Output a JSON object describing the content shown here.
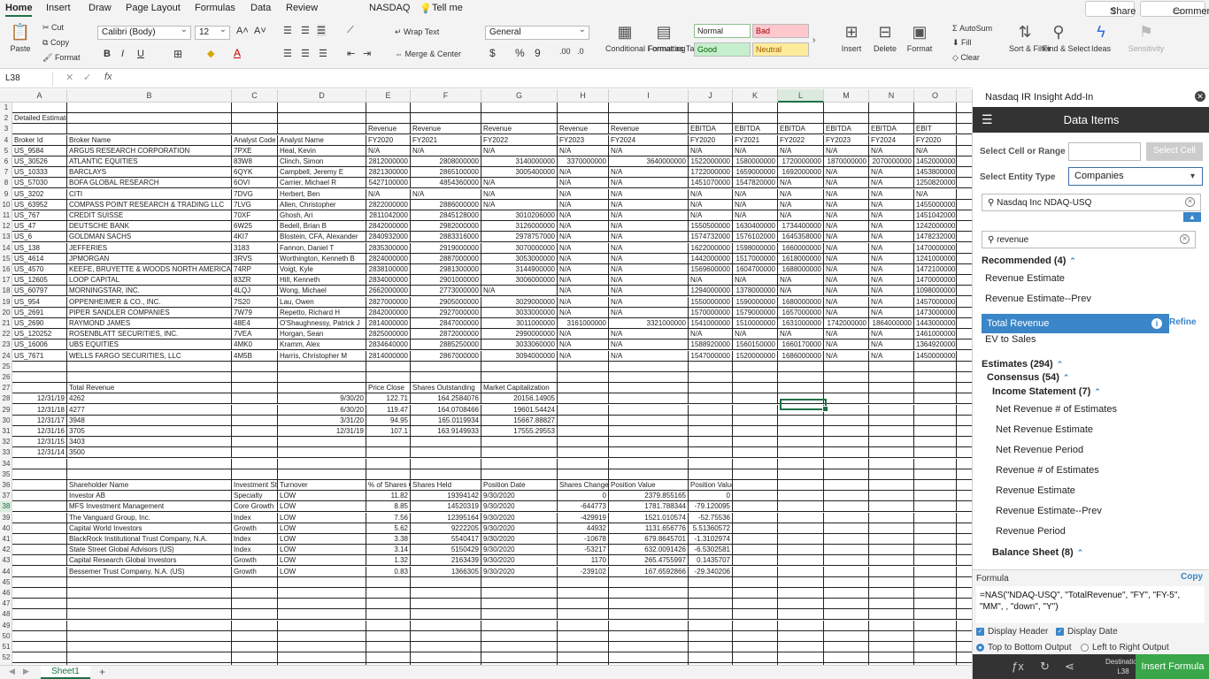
{
  "menu": {
    "tabs": [
      "Home",
      "Insert",
      "Draw",
      "Page Layout",
      "Formulas",
      "Data",
      "Review",
      "NASDAQ"
    ],
    "tell_me": "Tell me",
    "share": "Share",
    "comments": "Comments"
  },
  "ribbon": {
    "paste": "Paste",
    "cut": "Cut",
    "copy": "Copy",
    "format": "Format",
    "font_name": "Calibri (Body)",
    "font_size": "12",
    "wrap_text": "Wrap Text",
    "merge_center": "Merge & Center",
    "number_format": "General",
    "conditional": "Conditional Formatting",
    "format_table": "Format as Table",
    "style_normal": "Normal",
    "style_bad": "Bad",
    "style_good": "Good",
    "style_neutral": "Neutral",
    "insert": "Insert",
    "delete": "Delete",
    "format2": "Format",
    "autosum": "AutoSum",
    "fill": "Fill",
    "clear": "Clear",
    "sort_filter": "Sort & Filter",
    "find_select": "Find & Select",
    "ideas": "Ideas",
    "sensitivity": "Sensitivity"
  },
  "formula_bar": {
    "name_box": "L38",
    "fx": "fx"
  },
  "columns": [
    {
      "label": "A"
    },
    {
      "label": "B"
    },
    {
      "label": "C"
    },
    {
      "label": "D"
    },
    {
      "label": "E"
    },
    {
      "label": "F"
    },
    {
      "label": "G"
    },
    {
      "label": "H"
    },
    {
      "label": "I"
    },
    {
      "label": "J"
    },
    {
      "label": "K"
    },
    {
      "label": "L"
    },
    {
      "label": "M"
    },
    {
      "label": "N"
    },
    {
      "label": "O"
    }
  ],
  "row_numbers": [
    "1",
    "2",
    "3",
    "4",
    "5",
    "6",
    "7",
    "8",
    "9",
    "10",
    "11",
    "12",
    "13",
    "14",
    "15",
    "16",
    "17",
    "18",
    "19",
    "20",
    "21",
    "22",
    "23",
    "24",
    "25",
    "26",
    "27",
    "28",
    "29",
    "30",
    "31",
    "32",
    "33",
    "34",
    "35",
    "36",
    "37",
    "38",
    "39",
    "40",
    "41",
    "42",
    "43",
    "44",
    "45",
    "46",
    "47",
    "48",
    "49",
    "50",
    "51",
    "52",
    "53",
    "54",
    "55"
  ],
  "rows": [
    [],
    [
      "Detailed Estimates"
    ],
    [
      "",
      "",
      "",
      "",
      "Revenue",
      "Revenue",
      "Revenue",
      "Revenue",
      "Revenue",
      "EBITDA",
      "EBITDA",
      "EBITDA",
      "EBITDA",
      "EBITDA",
      "EBIT"
    ],
    [
      "Broker Id",
      "Broker Name",
      "Analyst Code",
      "Analyst Name",
      "FY2020",
      "FY2021",
      "FY2022",
      "FY2023",
      "FY2024",
      "FY2020",
      "FY2021",
      "FY2022",
      "FY2023",
      "FY2024",
      "FY2020"
    ],
    [
      "US_9584",
      "ARGUS RESEARCH CORPORATION",
      "7PXE",
      "Heal, Kevin",
      "N/A",
      "N/A",
      "N/A",
      "N/A",
      "N/A",
      "N/A",
      "N/A",
      "N/A",
      "N/A",
      "N/A",
      "N/A"
    ],
    [
      "US_30526",
      "ATLANTIC EQUITIES",
      "83W8",
      "Clinch, Simon",
      "2812000000",
      "2808000000",
      "3140000000",
      "3370000000",
      "3640000000",
      "1522000000",
      "1580000000",
      "1720000000",
      "1870000000",
      "2070000000",
      "1452000000"
    ],
    [
      "US_10333",
      "BARCLAYS",
      "6QYK",
      "Campbell, Jeremy E",
      "2821300000",
      "2865100000",
      "3005400000",
      "N/A",
      "N/A",
      "1722000000",
      "1659000000",
      "1692000000",
      "N/A",
      "N/A",
      "1453800000"
    ],
    [
      "US_57030",
      "BOFA GLOBAL RESEARCH",
      "6OVI",
      "Carrier, Michael R",
      "5427100000",
      "4854360000",
      "N/A",
      "N/A",
      "N/A",
      "1451070000",
      "1547820000",
      "N/A",
      "N/A",
      "N/A",
      "1250820000"
    ],
    [
      "US_3202",
      "CITI",
      "7DVG",
      "Herbert, Ben",
      "N/A",
      "N/A",
      "N/A",
      "N/A",
      "N/A",
      "N/A",
      "N/A",
      "N/A",
      "N/A",
      "N/A",
      "N/A"
    ],
    [
      "US_63952",
      "COMPASS POINT RESEARCH & TRADING LLC",
      "7LVG",
      "Allen, Christopher",
      "2822000000",
      "2886000000",
      "N/A",
      "N/A",
      "N/A",
      "N/A",
      "N/A",
      "N/A",
      "N/A",
      "N/A",
      "1455000000"
    ],
    [
      "US_767",
      "CREDIT SUISSE",
      "70XF",
      "Ghosh, Ari",
      "2811042000",
      "2845128000",
      "3010206000",
      "N/A",
      "N/A",
      "N/A",
      "N/A",
      "N/A",
      "N/A",
      "N/A",
      "1451042000"
    ],
    [
      "US_47",
      "DEUTSCHE BANK",
      "6W25",
      "Bedell, Brian B",
      "2842000000",
      "2982000000",
      "3126000000",
      "N/A",
      "N/A",
      "1550500000",
      "1630400000",
      "1734400000",
      "N/A",
      "N/A",
      "1242000000"
    ],
    [
      "US_6",
      "GOLDMAN SACHS",
      "4KI7",
      "Blostein, CFA, Alexander",
      "2840932000",
      "2883316000",
      "2978757000",
      "N/A",
      "N/A",
      "1574732000",
      "1576102000",
      "1645358000",
      "N/A",
      "N/A",
      "1478232000"
    ],
    [
      "US_138",
      "JEFFERIES",
      "3183",
      "Fannon, Daniel T",
      "2835300000",
      "2919000000",
      "3070000000",
      "N/A",
      "N/A",
      "1622000000",
      "1598000000",
      "1660000000",
      "N/A",
      "N/A",
      "1470000000"
    ],
    [
      "US_4614",
      "JPMORGAN",
      "3RVS",
      "Worthington, Kenneth B",
      "2824000000",
      "2887000000",
      "3053000000",
      "N/A",
      "N/A",
      "1442000000",
      "1517000000",
      "1618000000",
      "N/A",
      "N/A",
      "1241000000"
    ],
    [
      "US_4570",
      "KEEFE, BRUYETTE & WOODS NORTH AMERICA",
      "74RP",
      "Voigt, Kyle",
      "2838100000",
      "2981300000",
      "3144900000",
      "N/A",
      "N/A",
      "1569600000",
      "1604700000",
      "1688000000",
      "N/A",
      "N/A",
      "1472100000"
    ],
    [
      "US_12605",
      "LOOP CAPITAL",
      "83ZR",
      "Hill, Kenneth",
      "2834000000",
      "2901000000",
      "3006000000",
      "N/A",
      "N/A",
      "N/A",
      "N/A",
      "N/A",
      "N/A",
      "N/A",
      "1470000000"
    ],
    [
      "US_60797",
      "MORNINGSTAR, INC.",
      "4LQJ",
      "Wong, Michael",
      "2662000000",
      "2773000000",
      "N/A",
      "N/A",
      "N/A",
      "1294000000",
      "1378000000",
      "N/A",
      "N/A",
      "N/A",
      "1098000000"
    ],
    [
      "US_954",
      "OPPENHEIMER & CO., INC.",
      "7S20",
      "Lau, Owen",
      "2827000000",
      "2905000000",
      "3029000000",
      "N/A",
      "N/A",
      "1550000000",
      "1590000000",
      "1680000000",
      "N/A",
      "N/A",
      "1457000000"
    ],
    [
      "US_2691",
      "PIPER SANDLER COMPANIES",
      "7W79",
      "Repetto, Richard H",
      "2842000000",
      "2927000000",
      "3033000000",
      "N/A",
      "N/A",
      "1570000000",
      "1579000000",
      "1657000000",
      "N/A",
      "N/A",
      "1473000000"
    ],
    [
      "US_2690",
      "RAYMOND JAMES",
      "48E4",
      "O'Shaughnessy, Patrick J",
      "2814000000",
      "2847000000",
      "3011000000",
      "3161000000",
      "3321000000",
      "1541000000",
      "1510000000",
      "1631000000",
      "1742000000",
      "1864000000",
      "1443000000"
    ],
    [
      "US_120252",
      "ROSENBLATT SECURITIES, INC.",
      "7VEA",
      "Horgan, Sean",
      "2825000000",
      "2872000000",
      "2990000000",
      "N/A",
      "N/A",
      "N/A",
      "N/A",
      "N/A",
      "N/A",
      "N/A",
      "1461000000"
    ],
    [
      "US_16006",
      "UBS EQUITIES",
      "4MK0",
      "Kramm, Alex",
      "2834640000",
      "2885250000",
      "3033060000",
      "N/A",
      "N/A",
      "1588920000",
      "1560150000",
      "1660170000",
      "N/A",
      "N/A",
      "1364920000"
    ],
    [
      "US_7671",
      "WELLS FARGO SECURITIES, LLC",
      "4M5B",
      "Harris, Christopher M",
      "2814000000",
      "2867000000",
      "3094000000",
      "N/A",
      "N/A",
      "1547000000",
      "1520000000",
      "1686000000",
      "N/A",
      "N/A",
      "1450000000"
    ],
    [],
    [],
    [
      "",
      "Total Revenue",
      "",
      "",
      "Price Close",
      "Shares Outstanding",
      "Market Capitalization"
    ],
    [
      "12/31/19",
      "4262",
      "",
      "9/30/20",
      "122.71",
      "164.2584076",
      "20156.14905"
    ],
    [
      "12/31/18",
      "4277",
      "",
      "6/30/20",
      "119.47",
      "164.0708466",
      "19601.54424"
    ],
    [
      "12/31/17",
      "3948",
      "",
      "3/31/20",
      "94.95",
      "165.0119934",
      "15667.88827"
    ],
    [
      "12/31/16",
      "3705",
      "",
      "12/31/19",
      "107.1",
      "163.9149933",
      "17555.29553"
    ],
    [
      "12/31/15",
      "3403"
    ],
    [
      "12/31/14",
      "3500"
    ],
    [],
    [],
    [
      "",
      "Shareholder Name",
      "Investment St",
      "Turnover",
      "% of Shares C",
      "Shares Held",
      "Position Date",
      "Shares Change",
      "Position Value",
      "Position Value Change"
    ],
    [
      "",
      "Investor AB",
      "Specialty",
      "LOW",
      "11.82",
      "19394142",
      "9/30/2020",
      "0",
      "2379.855165",
      "0"
    ],
    [
      "",
      "MFS Investment Management",
      "Core Growth",
      "LOW",
      "8.85",
      "14520319",
      "9/30/2020",
      "-644773",
      "1781.788344",
      "-79.120095"
    ],
    [
      "",
      "The Vanguard Group, Inc.",
      "Index",
      "LOW",
      "7.56",
      "12395164",
      "9/30/2020",
      "-429919",
      "1521.010574",
      "-52.75536"
    ],
    [
      "",
      "Capital World Investors",
      "Growth",
      "LOW",
      "5.62",
      "9222205",
      "9/30/2020",
      "44932",
      "1131.656776",
      "5.51360572"
    ],
    [
      "",
      "BlackRock Institutional Trust Company, N.A.",
      "Index",
      "LOW",
      "3.38",
      "5540417",
      "9/30/2020",
      "-10678",
      "679.8645701",
      "-1.3102974"
    ],
    [
      "",
      "State Street Global Advisors (US)",
      "Index",
      "LOW",
      "3.14",
      "5150429",
      "9/30/2020",
      "-53217",
      "632.0091426",
      "-6.5302581"
    ],
    [
      "",
      "Capital Research Global Investors",
      "Growth",
      "LOW",
      "1.32",
      "2163439",
      "9/30/2020",
      "1170",
      "265.4755997",
      "0.1435707"
    ],
    [
      "",
      "Bessemer Trust Company, N.A. (US)",
      "Growth",
      "LOW",
      "0.83",
      "1366305",
      "9/30/2020",
      "-239102",
      "167.6592866",
      "-29.340206"
    ]
  ],
  "sheet": {
    "tab": "Sheet1"
  },
  "pane": {
    "title": "Nasdaq IR Insight Add-In",
    "header": "Data Items",
    "select_cell_label": "Select Cell or Range",
    "select_cell_btn": "Select Cell",
    "entity_type_label": "Select Entity Type",
    "entity_type_value": "Companies",
    "entity_search": "Nasdaq Inc  NDAQ-USQ",
    "item_search": "revenue",
    "refine": "Refine",
    "items": [
      {
        "label": "Recommended (4)",
        "kind": "h"
      },
      {
        "label": "Revenue Estimate",
        "kind": ""
      },
      {
        "label": "Revenue Estimate--Prev",
        "kind": ""
      },
      {
        "label": "Total Revenue",
        "kind": "sel"
      },
      {
        "label": "EV to Sales",
        "kind": ""
      },
      {
        "label": "Estimates (294)",
        "kind": "h"
      },
      {
        "label": "Consensus (54)",
        "kind": "h"
      },
      {
        "label": "Income Statement (7)",
        "kind": "h"
      },
      {
        "label": "Net Revenue # of Estimates",
        "kind": ""
      },
      {
        "label": "Net Revenue Estimate",
        "kind": ""
      },
      {
        "label": "Net Revenue Period",
        "kind": ""
      },
      {
        "label": "Revenue # of Estimates",
        "kind": ""
      },
      {
        "label": "Revenue Estimate",
        "kind": ""
      },
      {
        "label": "Revenue Estimate--Prev",
        "kind": ""
      },
      {
        "label": "Revenue Period",
        "kind": ""
      },
      {
        "label": "Balance Sheet (8)",
        "kind": "h"
      }
    ],
    "formula_label": "Formula",
    "copy": "Copy",
    "formula": "=NAS(\"NDAQ-USQ\", \"TotalRevenue\", \"FY\", \"FY-5\", \"MM\", , \"down\", \"Y\")",
    "display_header": "Display Header",
    "display_date": "Display Date",
    "top_bottom": "Top to Bottom Output",
    "left_right": "Left to Right Output",
    "destination_label": "Destination",
    "destination_value": "L38",
    "insert_formula": "Insert Formula"
  }
}
